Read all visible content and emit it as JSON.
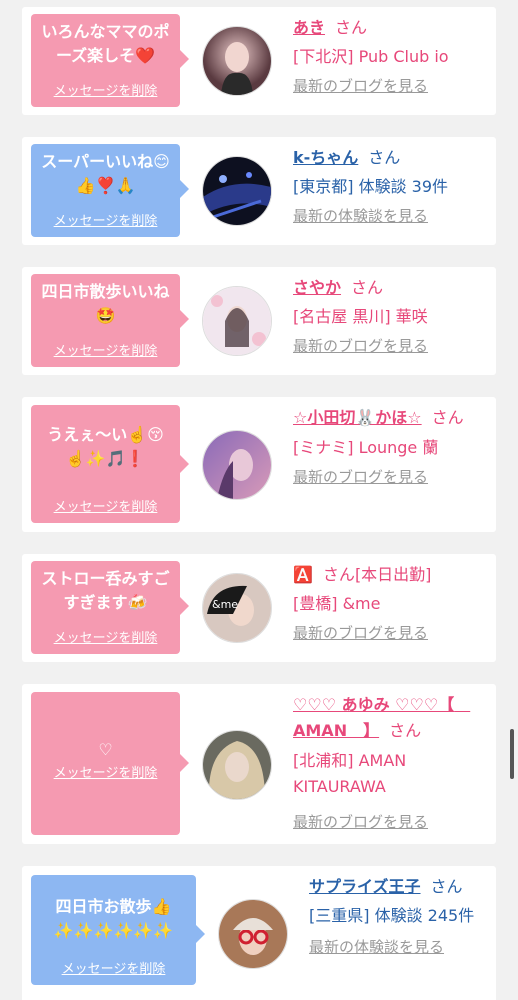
{
  "delete_label": "メッセージを削除",
  "san": "さん",
  "cards": [
    {
      "message": "いろんなママのポーズ楽しそ❤️",
      "name": "あき",
      "shop": "[下北沢] Pub Club io",
      "link": "最新のブログを見る"
    },
    {
      "message": "スーパーいいね😊👍❣️🙏",
      "name": "k-ちゃん",
      "shop": "[東京都] 体験談 39件",
      "link": "最新の体験談を見る"
    },
    {
      "message": "四日市散歩いいね🤩",
      "name": "さやか",
      "shop": "[名古屋 黒川] 華咲",
      "link": "最新のブログを見る"
    },
    {
      "message": "うえぇ〜い☝️😚☝️✨🎵❗️",
      "name": "☆小田切🐰かほ☆",
      "shop": "[ミナミ] Lounge 蘭",
      "link": "最新のブログを見る"
    },
    {
      "message": "ストロー呑みすごすぎます🍻",
      "name": "🅰️",
      "status": "[本日出勤]",
      "shop": "[豊橋] &me",
      "link": "最新のブログを見る"
    },
    {
      "message": "♡",
      "name": "♡♡♡ あゆみ ♡♡♡【　AMAN　】",
      "shop": "[北浦和] AMAN KITAURAWA",
      "link": "最新のブログを見る"
    },
    {
      "message": "四日市お散歩👍✨✨✨✨✨✨",
      "name": "サプライズ王子",
      "shop": "[三重県] 体験談 245件",
      "link": "最新の体験談を見る"
    }
  ],
  "colors": {
    "pink": "#f59ab1",
    "blue": "#8db7f2",
    "name_pink": "#e7487a",
    "name_blue": "#2a62a8"
  }
}
